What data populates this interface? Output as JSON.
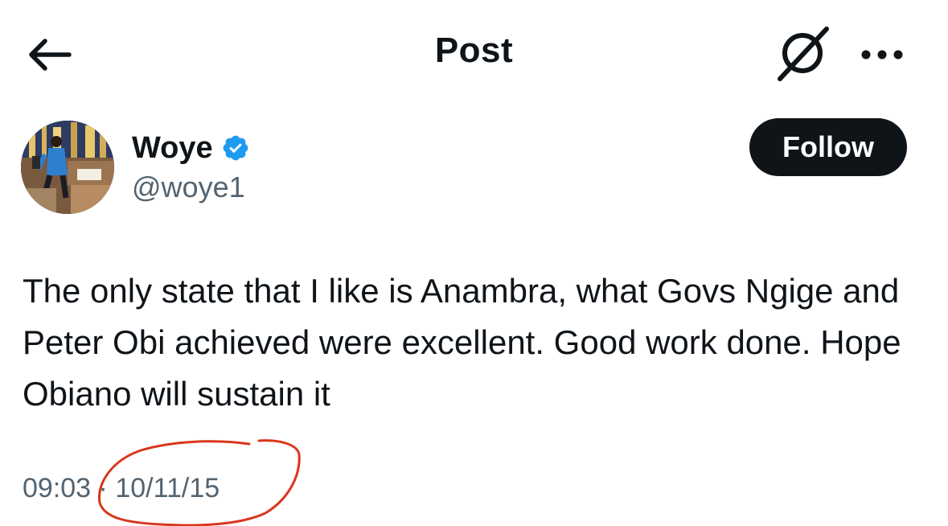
{
  "header": {
    "title": "Post",
    "back_icon": "back-arrow-icon",
    "grok_icon": "grok-icon",
    "more_icon": "more-icon"
  },
  "author": {
    "display_name": "Woye",
    "handle": "@woye1",
    "verified": true,
    "verified_color": "#1d9bf0",
    "follow_label": "Follow"
  },
  "post": {
    "text": "The only state that I like is Anambra, what Govs Ngige and Peter Obi achieved were excellent. Good work done. Hope Obiano will sustain it",
    "time": "09:03",
    "separator": "·",
    "date": "10/11/15"
  },
  "annotation": {
    "color": "#d9361e"
  }
}
